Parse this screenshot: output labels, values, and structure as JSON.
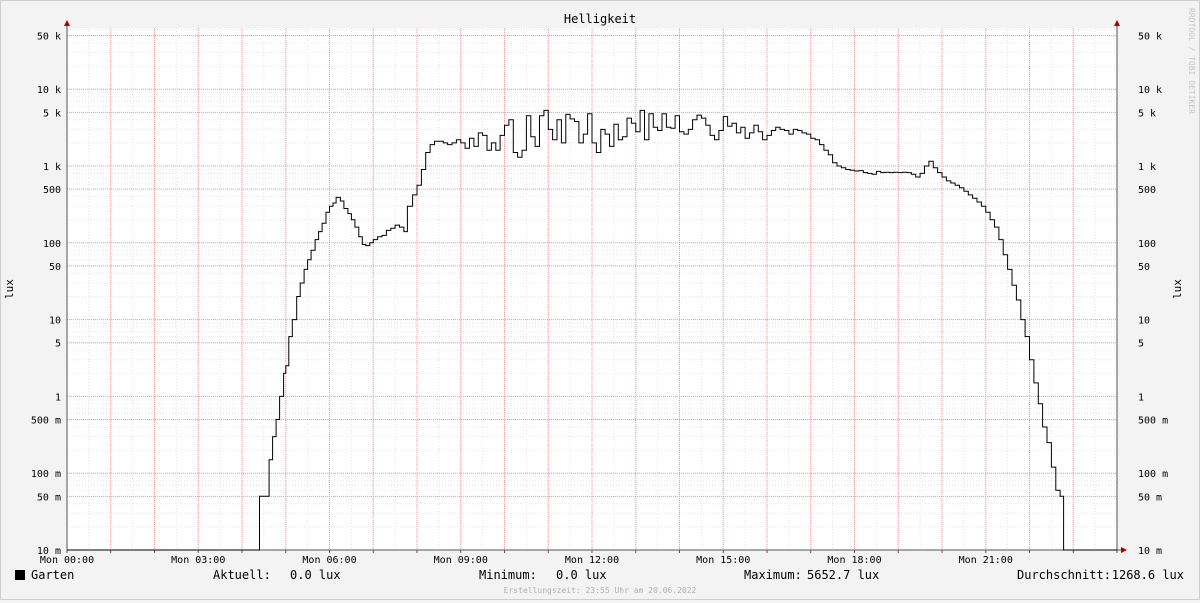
{
  "chart_data": {
    "type": "line",
    "title": "Helligkeit",
    "ylabel": "lux",
    "ylabel_right": "lux",
    "y_scale": "log",
    "ylim": [
      0.01,
      70000
    ],
    "xlim": [
      0,
      24
    ],
    "x_ticks": [
      {
        "x": 0,
        "label": "Mon 00:00"
      },
      {
        "x": 3,
        "label": "Mon 03:00"
      },
      {
        "x": 6,
        "label": "Mon 06:00"
      },
      {
        "x": 9,
        "label": "Mon 09:00"
      },
      {
        "x": 12,
        "label": "Mon 12:00"
      },
      {
        "x": 15,
        "label": "Mon 15:00"
      },
      {
        "x": 18,
        "label": "Mon 18:00"
      },
      {
        "x": 21,
        "label": "Mon 21:00"
      }
    ],
    "y_ticks": [
      {
        "v": 0.01,
        "label": "10 m"
      },
      {
        "v": 0.05,
        "label": "50 m"
      },
      {
        "v": 0.1,
        "label": "100 m"
      },
      {
        "v": 0.5,
        "label": "500 m"
      },
      {
        "v": 1,
        "label": "1"
      },
      {
        "v": 5,
        "label": "5"
      },
      {
        "v": 10,
        "label": "10"
      },
      {
        "v": 50,
        "label": "50"
      },
      {
        "v": 100,
        "label": "100"
      },
      {
        "v": 500,
        "label": "500"
      },
      {
        "v": 1000,
        "label": "1 k"
      },
      {
        "v": 5000,
        "label": "5 k"
      },
      {
        "v": 10000,
        "label": "10 k"
      },
      {
        "v": 50000,
        "label": "50 k"
      }
    ],
    "grid": true,
    "series": [
      {
        "name": "Garten",
        "color": "#000000",
        "points": [
          [
            0,
            0.01
          ],
          [
            4.4,
            0.01
          ],
          [
            4.4,
            0.05
          ],
          [
            4.6,
            0.05
          ],
          [
            4.62,
            0.15
          ],
          [
            4.7,
            0.3
          ],
          [
            4.78,
            0.5
          ],
          [
            4.86,
            1
          ],
          [
            4.95,
            2
          ],
          [
            5.0,
            2.5
          ],
          [
            5.07,
            6
          ],
          [
            5.15,
            10
          ],
          [
            5.25,
            20
          ],
          [
            5.33,
            30
          ],
          [
            5.42,
            45
          ],
          [
            5.5,
            60
          ],
          [
            5.58,
            80
          ],
          [
            5.67,
            110
          ],
          [
            5.75,
            140
          ],
          [
            5.83,
            180
          ],
          [
            5.92,
            250
          ],
          [
            6.0,
            300
          ],
          [
            6.08,
            330
          ],
          [
            6.15,
            390
          ],
          [
            6.25,
            350
          ],
          [
            6.33,
            280
          ],
          [
            6.42,
            240
          ],
          [
            6.5,
            200
          ],
          [
            6.58,
            160
          ],
          [
            6.67,
            120
          ],
          [
            6.75,
            95
          ],
          [
            6.83,
            92
          ],
          [
            6.92,
            100
          ],
          [
            7.0,
            110
          ],
          [
            7.1,
            120
          ],
          [
            7.2,
            125
          ],
          [
            7.3,
            145
          ],
          [
            7.4,
            155
          ],
          [
            7.5,
            170
          ],
          [
            7.6,
            160
          ],
          [
            7.7,
            140
          ],
          [
            7.78,
            300
          ],
          [
            7.9,
            420
          ],
          [
            8.0,
            560
          ],
          [
            8.1,
            900
          ],
          [
            8.2,
            1500
          ],
          [
            8.3,
            1900
          ],
          [
            8.4,
            2100
          ],
          [
            8.5,
            2100
          ],
          [
            8.6,
            2000
          ],
          [
            8.7,
            1900
          ],
          [
            8.8,
            2000
          ],
          [
            8.9,
            2200
          ],
          [
            9.0,
            2000
          ],
          [
            9.1,
            1700
          ],
          [
            9.2,
            2300
          ],
          [
            9.3,
            1800
          ],
          [
            9.4,
            2700
          ],
          [
            9.5,
            2500
          ],
          [
            9.6,
            1600
          ],
          [
            9.7,
            2000
          ],
          [
            9.8,
            1600
          ],
          [
            9.9,
            2500
          ],
          [
            10.0,
            3400
          ],
          [
            10.1,
            4000
          ],
          [
            10.2,
            1500
          ],
          [
            10.3,
            1300
          ],
          [
            10.4,
            1600
          ],
          [
            10.5,
            4500
          ],
          [
            10.6,
            2400
          ],
          [
            10.7,
            1800
          ],
          [
            10.8,
            4500
          ],
          [
            10.9,
            5300
          ],
          [
            11.0,
            3000
          ],
          [
            11.1,
            2200
          ],
          [
            11.2,
            4000
          ],
          [
            11.3,
            2000
          ],
          [
            11.4,
            4700
          ],
          [
            11.5,
            4100
          ],
          [
            11.6,
            3800
          ],
          [
            11.7,
            2000
          ],
          [
            11.8,
            2600
          ],
          [
            11.9,
            4800
          ],
          [
            12.0,
            2000
          ],
          [
            12.1,
            1500
          ],
          [
            12.2,
            3000
          ],
          [
            12.3,
            2600
          ],
          [
            12.4,
            1800
          ],
          [
            12.5,
            3500
          ],
          [
            12.6,
            2200
          ],
          [
            12.7,
            2400
          ],
          [
            12.8,
            4200
          ],
          [
            12.9,
            3600
          ],
          [
            13.0,
            2800
          ],
          [
            13.1,
            5300
          ],
          [
            13.2,
            2200
          ],
          [
            13.3,
            4800
          ],
          [
            13.4,
            3200
          ],
          [
            13.5,
            2900
          ],
          [
            13.6,
            4800
          ],
          [
            13.7,
            3200
          ],
          [
            13.8,
            3100
          ],
          [
            13.9,
            4500
          ],
          [
            14.0,
            2800
          ],
          [
            14.1,
            2600
          ],
          [
            14.2,
            3000
          ],
          [
            14.3,
            4000
          ],
          [
            14.4,
            4600
          ],
          [
            14.5,
            4200
          ],
          [
            14.6,
            3400
          ],
          [
            14.7,
            2500
          ],
          [
            14.8,
            2200
          ],
          [
            14.9,
            2900
          ],
          [
            15.0,
            4400
          ],
          [
            15.1,
            3300
          ],
          [
            15.2,
            3600
          ],
          [
            15.3,
            2700
          ],
          [
            15.4,
            3200
          ],
          [
            15.5,
            2300
          ],
          [
            15.6,
            2700
          ],
          [
            15.7,
            3400
          ],
          [
            15.8,
            2800
          ],
          [
            15.9,
            2200
          ],
          [
            16.0,
            2500
          ],
          [
            16.1,
            2900
          ],
          [
            16.2,
            3200
          ],
          [
            16.3,
            3000
          ],
          [
            16.4,
            2900
          ],
          [
            16.5,
            2600
          ],
          [
            16.6,
            3000
          ],
          [
            16.7,
            2900
          ],
          [
            16.8,
            2700
          ],
          [
            16.9,
            2600
          ],
          [
            17.0,
            2300
          ],
          [
            17.1,
            2200
          ],
          [
            17.2,
            1900
          ],
          [
            17.3,
            1600
          ],
          [
            17.4,
            1400
          ],
          [
            17.5,
            1100
          ],
          [
            17.6,
            1000
          ],
          [
            17.7,
            950
          ],
          [
            17.8,
            900
          ],
          [
            17.9,
            880
          ],
          [
            18.0,
            860
          ],
          [
            18.1,
            870
          ],
          [
            18.2,
            820
          ],
          [
            18.3,
            800
          ],
          [
            18.4,
            780
          ],
          [
            18.5,
            850
          ],
          [
            18.6,
            820
          ],
          [
            18.7,
            830
          ],
          [
            18.8,
            820
          ],
          [
            18.9,
            830
          ],
          [
            19.0,
            820
          ],
          [
            19.1,
            830
          ],
          [
            19.2,
            820
          ],
          [
            19.3,
            780
          ],
          [
            19.4,
            720
          ],
          [
            19.5,
            800
          ],
          [
            19.6,
            1000
          ],
          [
            19.7,
            1150
          ],
          [
            19.8,
            950
          ],
          [
            19.9,
            820
          ],
          [
            20.0,
            720
          ],
          [
            20.1,
            640
          ],
          [
            20.2,
            600
          ],
          [
            20.3,
            560
          ],
          [
            20.4,
            520
          ],
          [
            20.5,
            470
          ],
          [
            20.6,
            420
          ],
          [
            20.7,
            380
          ],
          [
            20.8,
            340
          ],
          [
            20.9,
            300
          ],
          [
            21.0,
            250
          ],
          [
            21.1,
            200
          ],
          [
            21.2,
            160
          ],
          [
            21.3,
            110
          ],
          [
            21.4,
            70
          ],
          [
            21.5,
            45
          ],
          [
            21.6,
            28
          ],
          [
            21.7,
            18
          ],
          [
            21.8,
            10
          ],
          [
            21.9,
            6
          ],
          [
            22.0,
            3
          ],
          [
            22.1,
            1.5
          ],
          [
            22.2,
            0.8
          ],
          [
            22.3,
            0.4
          ],
          [
            22.4,
            0.25
          ],
          [
            22.5,
            0.12
          ],
          [
            22.6,
            0.06
          ],
          [
            22.7,
            0.05
          ],
          [
            22.78,
            0.01
          ],
          [
            24,
            0.01
          ]
        ]
      }
    ]
  },
  "legend": {
    "series_name": "Garten",
    "swatch_color": "#000000",
    "aktuell_label": "Aktuell:",
    "aktuell_value": "0.0 lux",
    "minimum_label": "Minimum:",
    "minimum_value": "0.0 lux",
    "maximum_label": "Maximum:",
    "maximum_value": "5652.7 lux",
    "avg_label": "Durchschnitt:",
    "avg_value": "1268.6 lux"
  },
  "footer": "Erstellungszeit: 23:55 Uhr am 20.06.2022",
  "watermark": "RRDTOOL / TOBI OETIKER"
}
